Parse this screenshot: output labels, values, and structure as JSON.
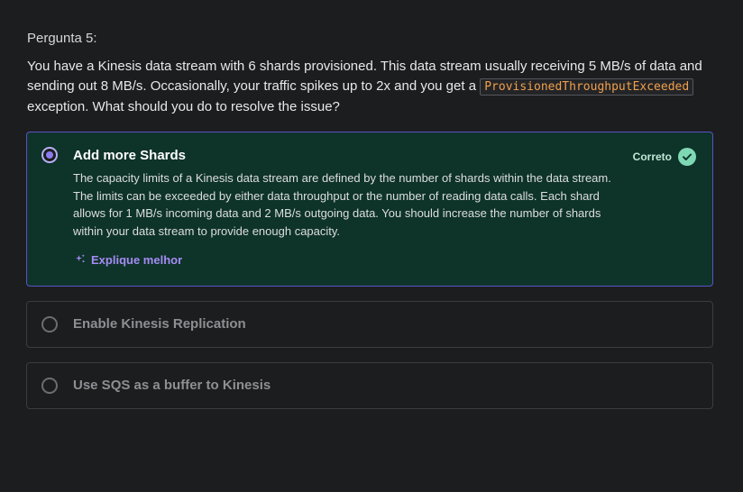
{
  "question": {
    "label": "Pergunta 5:",
    "text_before": "You have a Kinesis data stream with 6 shards provisioned. This data stream usually receiving 5 MB/s of data and sending out 8 MB/s. Occasionally, your traffic spikes up to 2x and you get a",
    "code": "ProvisionedThroughputExceeded",
    "text_after": "exception. What should you do to resolve the issue?"
  },
  "options": [
    {
      "title": "Add more Shards",
      "selected": true,
      "status": "Correto",
      "explanation": "The capacity limits of a Kinesis data stream are defined by the number of shards within the data stream. The limits can be exceeded by either data throughput or the number of reading data calls. Each shard allows for 1 MB/s incoming data and 2 MB/s outgoing data. You should increase the number of shards within your data stream to provide enough capacity.",
      "explain_link": "Explique melhor"
    },
    {
      "title": "Enable Kinesis Replication",
      "selected": false
    },
    {
      "title": "Use SQS as a buffer to Kinesis",
      "selected": false
    }
  ],
  "colors": {
    "background": "#1c1d1f",
    "correct_bg": "#0e3329",
    "correct_border": "#5a52c7",
    "accent_purple": "#a58cf4",
    "correct_green": "#7fd8b4",
    "code_orange": "#f1a04c"
  },
  "icons": {
    "check": "check-circle-icon",
    "sparkle": "sparkle-icon"
  }
}
